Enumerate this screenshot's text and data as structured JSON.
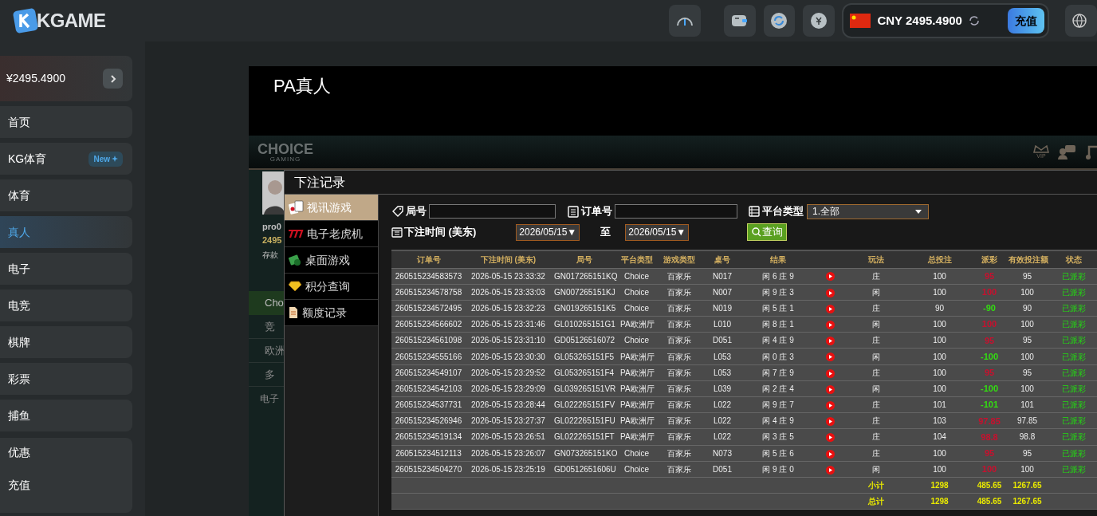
{
  "header": {
    "logo": "KGAME",
    "currency": "CNY 2495.4900",
    "recharge": "充值"
  },
  "sidebar": {
    "balance": "¥2495.4900",
    "items": [
      {
        "label": "首页",
        "selected": false
      },
      {
        "label": "KG体育",
        "selected": false,
        "badge": "New"
      },
      {
        "label": "体育",
        "selected": false
      },
      {
        "label": "真人",
        "selected": true
      },
      {
        "label": "电子",
        "selected": false
      },
      {
        "label": "电竞",
        "selected": false
      },
      {
        "label": "棋牌",
        "selected": false
      },
      {
        "label": "彩票",
        "selected": false
      },
      {
        "label": "捕鱼",
        "selected": false
      }
    ],
    "extra_items": [
      "优惠",
      "充值"
    ]
  },
  "page_title": "PA真人",
  "game": {
    "logo": "CHOICE",
    "logo_sub": "GAMING",
    "vip": "VIP",
    "lobby_peek": [
      "pro0",
      "2495",
      "存款",
      "Cho",
      "竞",
      "欧洲",
      "多",
      "电子"
    ]
  },
  "dialog": {
    "title": "下注记录",
    "menu": [
      {
        "label": "视讯游戏",
        "selected": true,
        "kind": "cards"
      },
      {
        "label": "电子老虎机",
        "selected": false,
        "kind": "slot"
      },
      {
        "label": "桌面游戏",
        "selected": false,
        "kind": "chips"
      },
      {
        "label": "积分查询",
        "selected": false,
        "kind": "diamond"
      },
      {
        "label": "额度记录",
        "selected": false,
        "kind": "doc"
      }
    ],
    "filters": {
      "round_label": "局号",
      "order_label": "订单号",
      "platform_label": "平台类型",
      "platform_value": "1.全部",
      "time_label": "下注时间 (美东)",
      "date_from": "2026/05/15▼",
      "to_label": "至",
      "date_to": "2026/05/15▼",
      "query": "查询"
    },
    "table": {
      "columns": [
        "订单号",
        "下注时间 (美东)",
        "局号",
        "平台类型",
        "游戏类型",
        "桌号",
        "结果",
        "玩法",
        "总投注",
        "派彩",
        "有效投注额",
        "状态"
      ],
      "rows": [
        {
          "order": "260515234583573",
          "time": "2026-05-15 23:33:32",
          "round": "GN017265151KQ",
          "platform": "Choice",
          "game": "百家乐",
          "table": "N017",
          "result": "闲 6 庄 9",
          "bet": "庄",
          "stake": "100",
          "payout": {
            "text": "95",
            "color": "#c8102e"
          },
          "valid": "95",
          "status": "已派彩"
        },
        {
          "order": "260515234578758",
          "time": "2026-05-15 23:33:03",
          "round": "GN007265151KJ",
          "platform": "Choice",
          "game": "百家乐",
          "table": "N007",
          "result": "闲 9 庄 3",
          "bet": "闲",
          "stake": "100",
          "payout": {
            "text": "100",
            "color": "#c8102e"
          },
          "valid": "100",
          "status": "已派彩"
        },
        {
          "order": "260515234572495",
          "time": "2026-05-15 23:32:23",
          "round": "GN019265151K5",
          "platform": "Choice",
          "game": "百家乐",
          "table": "N019",
          "result": "闲 5 庄 1",
          "bet": "庄",
          "stake": "90",
          "payout": {
            "text": "-90",
            "color": "#33dd11"
          },
          "valid": "90",
          "status": "已派彩"
        },
        {
          "order": "260515234566602",
          "time": "2026-05-15 23:31:46",
          "round": "GL010265151G1",
          "platform": "PA欧洲厅",
          "game": "百家乐",
          "table": "L010",
          "result": "闲 8 庄 1",
          "bet": "闲",
          "stake": "100",
          "payout": {
            "text": "100",
            "color": "#c8102e"
          },
          "valid": "100",
          "status": "已派彩"
        },
        {
          "order": "260515234561098",
          "time": "2026-05-15 23:31:10",
          "round": "GD05126516072",
          "platform": "Choice",
          "game": "百家乐",
          "table": "D051",
          "result": "闲 4 庄 9",
          "bet": "庄",
          "stake": "100",
          "payout": {
            "text": "95",
            "color": "#c8102e"
          },
          "valid": "95",
          "status": "已派彩"
        },
        {
          "order": "260515234555166",
          "time": "2026-05-15 23:30:30",
          "round": "GL053265151F5",
          "platform": "PA欧洲厅",
          "game": "百家乐",
          "table": "L053",
          "result": "闲 0 庄 3",
          "bet": "闲",
          "stake": "100",
          "payout": {
            "text": "-100",
            "color": "#33dd11"
          },
          "valid": "100",
          "status": "已派彩"
        },
        {
          "order": "260515234549107",
          "time": "2026-05-15 23:29:52",
          "round": "GL053265151F4",
          "platform": "PA欧洲厅",
          "game": "百家乐",
          "table": "L053",
          "result": "闲 7 庄 9",
          "bet": "庄",
          "stake": "100",
          "payout": {
            "text": "95",
            "color": "#c8102e"
          },
          "valid": "95",
          "status": "已派彩"
        },
        {
          "order": "260515234542103",
          "time": "2026-05-15 23:29:09",
          "round": "GL039265151VR",
          "platform": "PA欧洲厅",
          "game": "百家乐",
          "table": "L039",
          "result": "闲 2 庄 4",
          "bet": "闲",
          "stake": "100",
          "payout": {
            "text": "-100",
            "color": "#33dd11"
          },
          "valid": "100",
          "status": "已派彩"
        },
        {
          "order": "260515234537731",
          "time": "2026-05-15 23:28:44",
          "round": "GL022265151FV",
          "platform": "PA欧洲厅",
          "game": "百家乐",
          "table": "L022",
          "result": "闲 9 庄 7",
          "bet": "庄",
          "stake": "101",
          "payout": {
            "text": "-101",
            "color": "#33dd11"
          },
          "valid": "101",
          "status": "已派彩"
        },
        {
          "order": "260515234526946",
          "time": "2026-05-15 23:27:37",
          "round": "GL022265151FU",
          "platform": "PA欧洲厅",
          "game": "百家乐",
          "table": "L022",
          "result": "闲 4 庄 9",
          "bet": "庄",
          "stake": "103",
          "payout": {
            "text": "97.85",
            "color": "#c8102e"
          },
          "valid": "97.85",
          "status": "已派彩"
        },
        {
          "order": "260515234519134",
          "time": "2026-05-15 23:26:51",
          "round": "GL022265151FT",
          "platform": "PA欧洲厅",
          "game": "百家乐",
          "table": "L022",
          "result": "闲 3 庄 5",
          "bet": "庄",
          "stake": "104",
          "payout": {
            "text": "98.8",
            "color": "#c8102e"
          },
          "valid": "98.8",
          "status": "已派彩"
        },
        {
          "order": "260515234512113",
          "time": "2026-05-15 23:26:07",
          "round": "GN073265151KO",
          "platform": "Choice",
          "game": "百家乐",
          "table": "N073",
          "result": "闲 5 庄 6",
          "bet": "庄",
          "stake": "100",
          "payout": {
            "text": "95",
            "color": "#c8102e"
          },
          "valid": "95",
          "status": "已派彩"
        },
        {
          "order": "260515234504270",
          "time": "2026-05-15 23:25:19",
          "round": "GD0512651606U",
          "platform": "Choice",
          "game": "百家乐",
          "table": "D051",
          "result": "闲 9 庄 0",
          "bet": "闲",
          "stake": "100",
          "payout": {
            "text": "100",
            "color": "#c8102e"
          },
          "valid": "100",
          "status": "已派彩"
        }
      ],
      "totals": [
        {
          "label": "小计",
          "stake": "1298",
          "payout": "485.65",
          "valid": "1267.65"
        },
        {
          "label": "总计",
          "stake": "1298",
          "payout": "485.65",
          "valid": "1267.65"
        }
      ]
    }
  }
}
